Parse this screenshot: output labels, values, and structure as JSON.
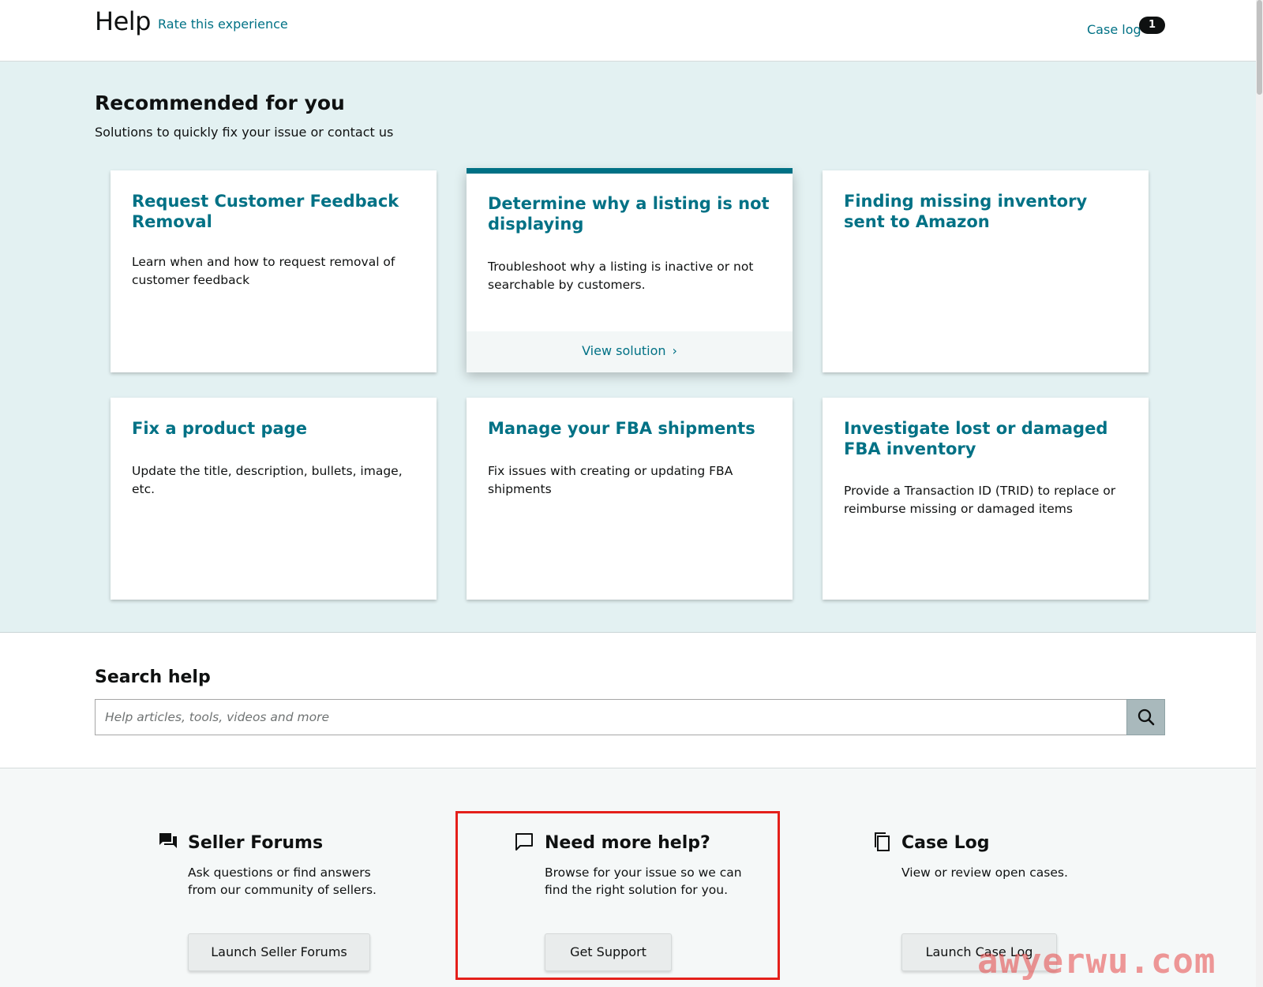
{
  "header": {
    "title": "Help",
    "rate_link": "Rate this experience",
    "case_log_link": "Case log",
    "case_log_count": "1"
  },
  "recommended": {
    "title": "Recommended for you",
    "subtitle": "Solutions to quickly fix your issue or contact us",
    "cards": [
      {
        "title": "Request Customer Feedback Removal",
        "description": "Learn when and how to request removal of customer feedback"
      },
      {
        "title": "Determine why a listing is not displaying",
        "description": "Troubleshoot why a listing is inactive or not searchable by customers.",
        "action": "View solution"
      },
      {
        "title": "Finding missing inventory sent to Amazon",
        "description": ""
      },
      {
        "title": "Fix a product page",
        "description": "Update the title, description, bullets, image, etc."
      },
      {
        "title": "Manage your FBA shipments",
        "description": "Fix issues with creating or updating FBA shipments"
      },
      {
        "title": "Investigate lost or damaged FBA inventory",
        "description": "Provide a Transaction ID (TRID) to replace or reimburse missing or damaged items"
      }
    ]
  },
  "search": {
    "title": "Search help",
    "placeholder": "Help articles, tools, videos and more",
    "button_icon": "search-icon"
  },
  "bottom": {
    "columns": [
      {
        "icon": "forum-icon",
        "title": "Seller Forums",
        "description": "Ask questions or find answers from our community of sellers.",
        "button": "Launch Seller Forums"
      },
      {
        "icon": "chat-bubble-icon",
        "title": "Need more help?",
        "description": "Browse for your issue so we can find the right solution for you.",
        "button": "Get Support"
      },
      {
        "icon": "copy-icon",
        "title": "Case Log",
        "description": "View or review open cases.",
        "button": "Launch Case Log"
      }
    ]
  },
  "watermark": "awyerwu.com",
  "colors": {
    "link": "#007185",
    "recommended_bg": "#e3f1f2",
    "highlight_border": "#e4201b"
  }
}
